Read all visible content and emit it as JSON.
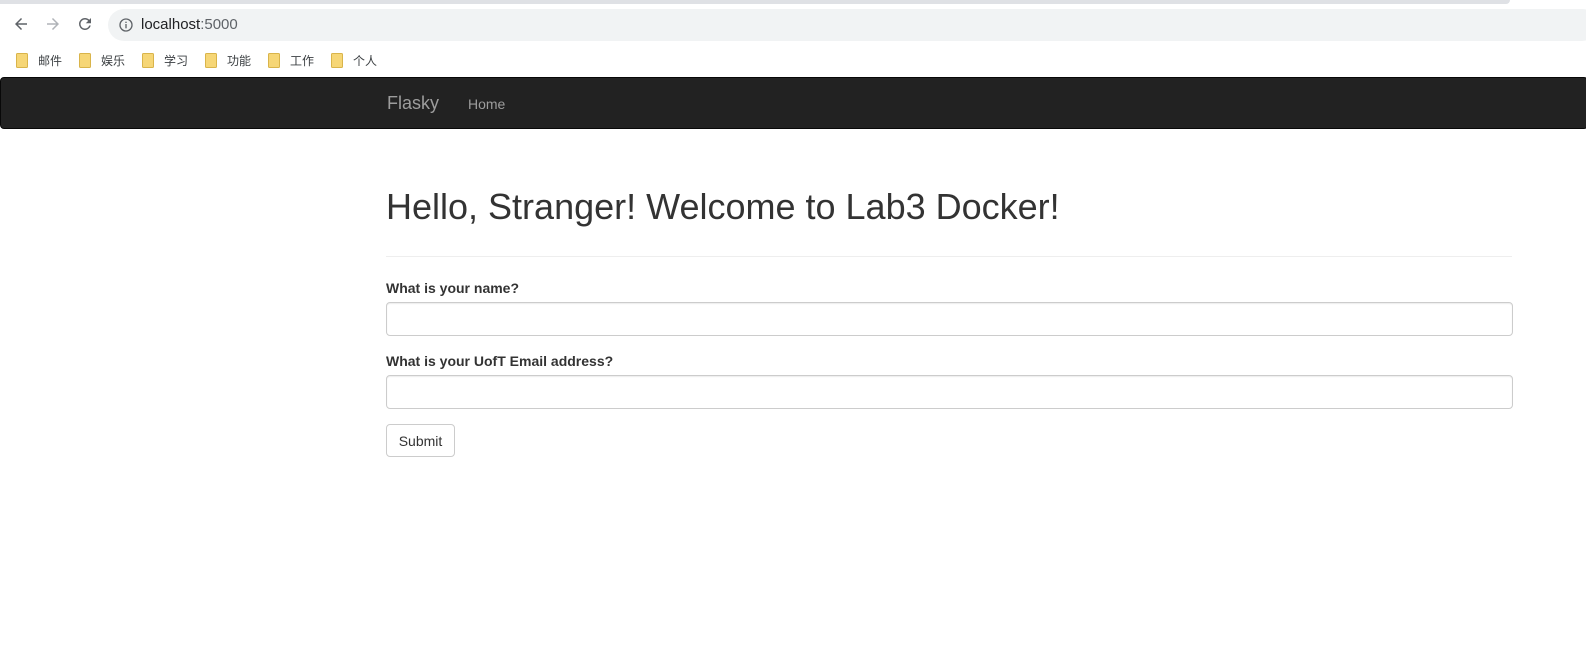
{
  "browser": {
    "url_host": "localhost",
    "url_port": ":5000",
    "bookmarks": [
      {
        "label": "邮件",
        "icon": "folder-icon"
      },
      {
        "label": "娱乐",
        "icon": "folder-icon"
      },
      {
        "label": "学习",
        "icon": "folder-icon"
      },
      {
        "label": "功能",
        "icon": "folder-icon"
      },
      {
        "label": "工作",
        "icon": "folder-icon"
      },
      {
        "label": "个人",
        "icon": "folder-icon"
      }
    ]
  },
  "navbar": {
    "brand": "Flasky",
    "links": [
      {
        "label": "Home"
      }
    ]
  },
  "main": {
    "title": "Hello, Stranger! Welcome to Lab3 Docker!",
    "form": {
      "name_label": "What is your name?",
      "name_value": "",
      "email_label": "What is your UofT Email address?",
      "email_value": "",
      "submit_label": "Submit"
    }
  },
  "colors": {
    "navbar_bg": "#222222",
    "navbar_text": "#9d9d9d",
    "folder": "#f6d676"
  }
}
